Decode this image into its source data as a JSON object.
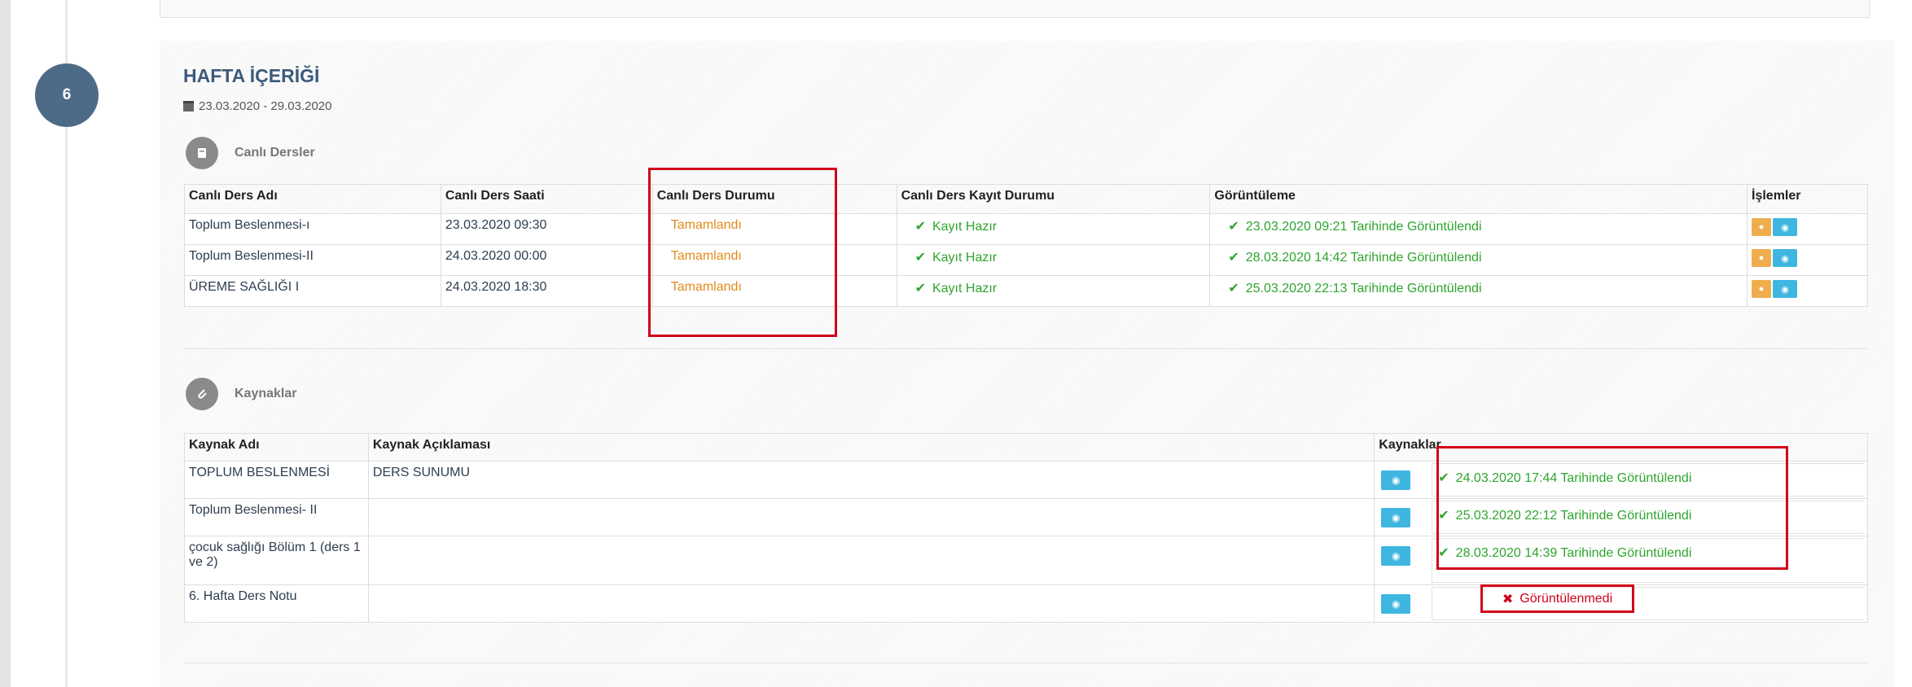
{
  "week": {
    "number": "6",
    "title": "HAFTA İÇERİĞİ",
    "date_range": "23.03.2020 - 29.03.2020"
  },
  "live": {
    "section_label": "Canlı Dersler",
    "headers": [
      "Canlı Ders Adı",
      "Canlı Ders Saati",
      "Canlı Ders Durumu",
      "Canlı Ders Kayıt Durumu",
      "Görüntüleme",
      "İşlemler"
    ],
    "rows": [
      {
        "name": "Toplum Beslenmesi-ı",
        "time": "23.03.2020 09:30",
        "status": "Tamamlandı",
        "record": "Kayıt Hazır",
        "viewed": "23.03.2020 09:21 Tarihinde Görüntülendi"
      },
      {
        "name": "Toplum Beslenmesi-II",
        "time": "24.03.2020 00:00",
        "status": "Tamamlandı",
        "record": "Kayıt Hazır",
        "viewed": "28.03.2020 14:42 Tarihinde Görüntülendi"
      },
      {
        "name": "ÜREME SAĞLIĞI I",
        "time": "24.03.2020 18:30",
        "status": "Tamamlandı",
        "record": "Kayıt Hazır",
        "viewed": "25.03.2020 22:13 Tarihinde Görüntülendi"
      }
    ]
  },
  "resources": {
    "section_label": "Kaynaklar",
    "headers": [
      "Kaynak Adı",
      "Kaynak Açıklaması",
      "Kaynaklar"
    ],
    "rows": [
      {
        "name": "TOPLUM BESLENMESİ",
        "desc": "DERS SUNUMU",
        "viewed": "24.03.2020 17:44 Tarihinde Görüntülendi"
      },
      {
        "name": "Toplum Beslenmesi- II",
        "desc": "",
        "viewed": "25.03.2020 22:12 Tarihinde Görüntülendi"
      },
      {
        "name": "çocuk sağlığı Bölüm 1 (ders 1 ve 2)",
        "desc": "",
        "viewed": "28.03.2020 14:39 Tarihinde Görüntülendi"
      },
      {
        "name": "6. Hafta Ders Notu",
        "desc": "",
        "viewed": ""
      }
    ],
    "not_viewed_label": "Görüntülenmedi"
  },
  "colors": {
    "badge": "#4d6a87",
    "completed": "#e48a1a",
    "viewed": "#2ea52e",
    "not_viewed": "#d0021b",
    "btn_orange": "#f0ad4e",
    "btn_blue": "#3fb6e0",
    "highlight": "#d0021b"
  },
  "icons": {
    "week_date": "calendar-icon",
    "live_section": "book-icon",
    "resource_section": "paperclip-icon",
    "check": "check-icon",
    "view": "eye-icon",
    "action": "play-icon",
    "cross": "times-icon"
  }
}
